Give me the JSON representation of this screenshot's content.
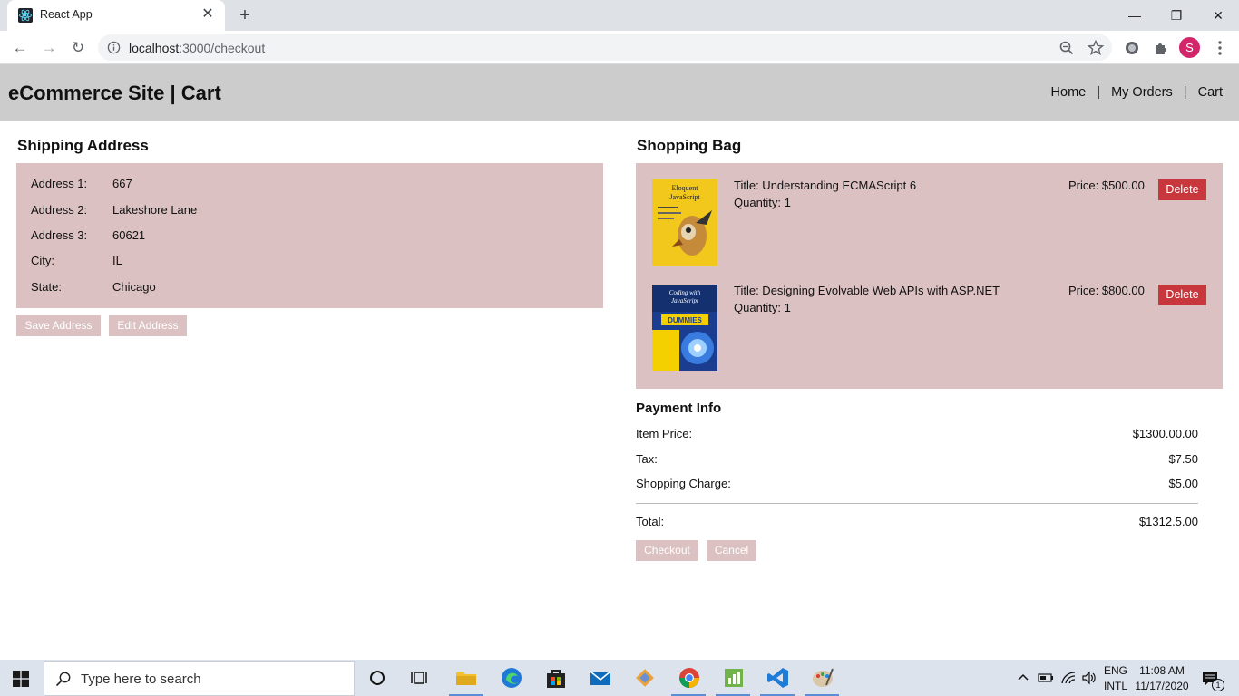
{
  "browser": {
    "tab_title": "React App",
    "tab_close": "✕",
    "new_tab": "+",
    "window_controls": {
      "minimize": "—",
      "restore": "❐",
      "close": "✕"
    },
    "nav": {
      "back": "←",
      "forward": "→",
      "reload": "↻"
    },
    "url_host": "localhost",
    "url_path": ":3000/checkout",
    "profile_initial": "S"
  },
  "header": {
    "title": "eCommerce Site | Cart",
    "nav": {
      "home": "Home",
      "orders": "My Orders",
      "cart": "Cart",
      "separator": "|"
    }
  },
  "shipping": {
    "title": "Shipping Address",
    "rows": [
      {
        "label": "Address 1:",
        "value": "667"
      },
      {
        "label": "Address 2:",
        "value": "Lakeshore Lane"
      },
      {
        "label": "Address 3:",
        "value": "60621"
      },
      {
        "label": "City:",
        "value": "IL"
      },
      {
        "label": "State:",
        "value": "Chicago"
      }
    ],
    "save_label": "Save Address",
    "edit_label": "Edit Address"
  },
  "bag": {
    "title": "Shopping Bag",
    "items": [
      {
        "title": "Title: Understanding ECMAScript 6",
        "qty": "Quantity: 1",
        "price": "Price: $500.00",
        "delete": "Delete",
        "cover_lines": [
          "Eloquent",
          "JavaScript"
        ]
      },
      {
        "title": "Title: Designing Evolvable Web APIs with ASP.NET",
        "qty": "Quantity: 1",
        "price": "Price: $800.00",
        "delete": "Delete",
        "cover_lines": [
          "Coding with",
          "JavaScript",
          "DUMMIES"
        ]
      }
    ]
  },
  "payment": {
    "title": "Payment Info",
    "rows": [
      {
        "label": "Item Price:",
        "value": "$1300.00.00"
      },
      {
        "label": "Tax:",
        "value": "$7.50"
      },
      {
        "label": "Shopping Charge:",
        "value": "$5.00"
      }
    ],
    "total_label": "Total:",
    "total_value": "$1312.5.00",
    "checkout_label": "Checkout",
    "cancel_label": "Cancel"
  },
  "taskbar": {
    "search_placeholder": "Type here to search",
    "lang_line1": "ENG",
    "lang_line2": "INTL",
    "time": "11:08 AM",
    "date": "11/17/2020",
    "notification_count": "1"
  }
}
